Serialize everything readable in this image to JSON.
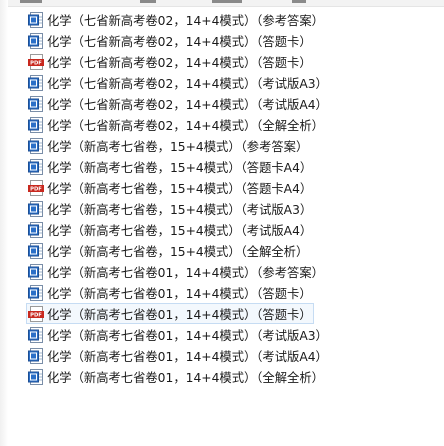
{
  "files": [
    {
      "name": "化学（七省新高考卷02，14+4模式）（参考答案）",
      "type": "word"
    },
    {
      "name": "化学（七省新高考卷02，14+4模式）（答题卡）",
      "type": "word"
    },
    {
      "name": "化学（七省新高考卷02，14+4模式）（答题卡）",
      "type": "pdf"
    },
    {
      "name": "化学（七省新高考卷02，14+4模式）（考试版A3）",
      "type": "word"
    },
    {
      "name": "化学（七省新高考卷02，14+4模式）（考试版A4）",
      "type": "word"
    },
    {
      "name": "化学（七省新高考卷02，14+4模式）（全解全析）",
      "type": "word"
    },
    {
      "name": "化学（新高考七省卷，15+4模式）（参考答案）",
      "type": "word"
    },
    {
      "name": "化学（新高考七省卷，15+4模式）（答题卡A4）",
      "type": "word"
    },
    {
      "name": "化学（新高考七省卷，15+4模式）（答题卡A4）",
      "type": "pdf"
    },
    {
      "name": "化学（新高考七省卷，15+4模式）（考试版A3）",
      "type": "word"
    },
    {
      "name": "化学（新高考七省卷，15+4模式）（考试版A4）",
      "type": "word"
    },
    {
      "name": "化学（新高考七省卷，15+4模式）（全解全析）",
      "type": "word"
    },
    {
      "name": "化学（新高考七省卷01，14+4模式）（参考答案）",
      "type": "word"
    },
    {
      "name": "化学（新高考七省卷01，14+4模式）（答题卡）",
      "type": "word"
    },
    {
      "name": "化学（新高考七省卷01，14+4模式）（答题卡）",
      "type": "pdf",
      "selected": true
    },
    {
      "name": "化学（新高考七省卷01，14+4模式）（考试版A3）",
      "type": "word"
    },
    {
      "name": "化学（新高考七省卷01，14+4模式）（考试版A4）",
      "type": "word"
    },
    {
      "name": "化学（新高考七省卷01，14+4模式）（全解全析）",
      "type": "word"
    }
  ],
  "icons": {
    "word": "word-document-icon",
    "pdf": "pdf-document-icon"
  },
  "colors": {
    "word_blue": "#2b6fc7",
    "pdf_red": "#c8281e",
    "selection_border": "#c6dcf3",
    "selection_fill": "#f3f8fd"
  }
}
